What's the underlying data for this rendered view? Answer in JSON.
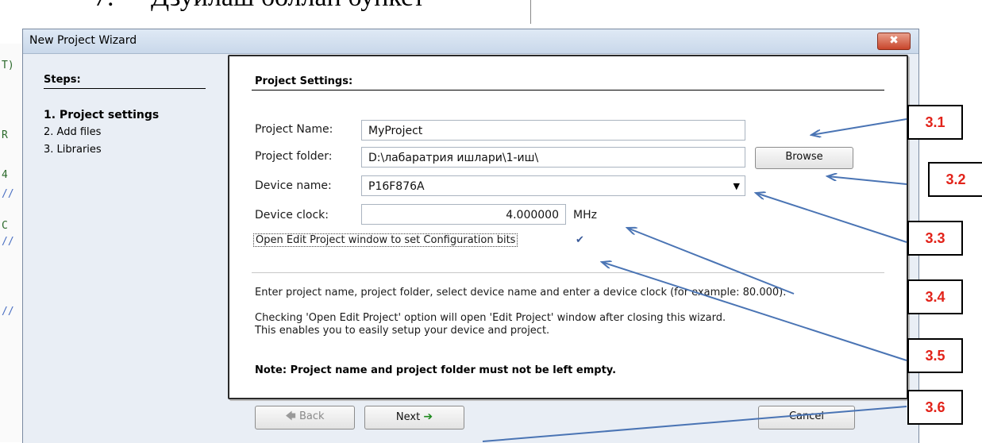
{
  "document": {
    "number": "7.",
    "heading": "Дзуилаш боллан бункст"
  },
  "gutter": [
    "T)",
    "R",
    "4",
    "C",
    "//",
    "//",
    "//"
  ],
  "window": {
    "title": "New Project Wizard",
    "close_glyph": "✖"
  },
  "steps": {
    "title": "Steps:",
    "items": [
      "1. Project settings",
      "2. Add files",
      "3. Libraries"
    ]
  },
  "settings": {
    "title": "Project Settings:",
    "project_name_label": "Project Name:",
    "project_name_value": "MyProject",
    "project_folder_label": "Project folder:",
    "project_folder_value": "D:\\лабаратрия ишлари\\1-иш\\",
    "browse_label": "Browse",
    "device_name_label": "Device name:",
    "device_name_value": "P16F876A",
    "device_clock_label": "Device clock:",
    "device_clock_value": "4.000000",
    "device_clock_unit": "MHz",
    "open_edit_label": "Open Edit Project window to set Configuration bits",
    "open_edit_checked": "✔",
    "info1": "Enter project name, project folder, select device name and enter a device clock (for example: 80.000).",
    "info2": "Checking 'Open Edit Project' option will open 'Edit Project' window after closing this wizard.",
    "info3": "This enables you to easily setup your device and project.",
    "note": "Note: Project name and project folder must not be left empty."
  },
  "buttons": {
    "back": "Back",
    "next": "Next",
    "cancel": "Cancel",
    "back_arrow": "🡄",
    "next_arrow": "➔"
  },
  "callouts": [
    "3.1",
    "3.2",
    "3.3",
    "3.4",
    "3.5",
    "3.6"
  ]
}
